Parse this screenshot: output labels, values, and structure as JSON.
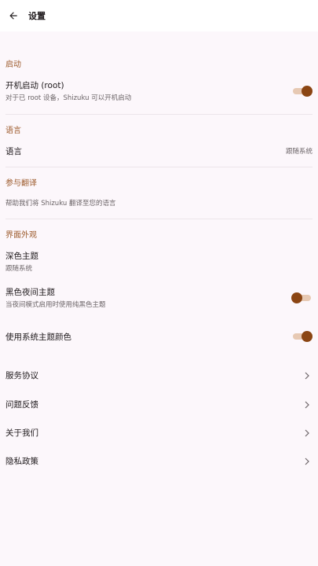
{
  "appbar": {
    "title": "设置"
  },
  "startup": {
    "section": "启动",
    "boot_title": "开机启动 (root)",
    "boot_sub": "对于已 root 设备，Shizuku 可以开机启动",
    "boot_on": true
  },
  "language": {
    "section": "语言",
    "item_title": "语言",
    "item_value": "跟随系统"
  },
  "translate": {
    "section": "参与翻译",
    "item_sub": "帮助我们将 Shizuku 翻译至您的语言"
  },
  "appearance": {
    "section": "界面外观",
    "dark_title": "深色主题",
    "dark_sub": "跟随系统",
    "black_title": "黑色夜间主题",
    "black_sub": "当夜间模式启用时使用纯黑色主题",
    "black_on": false,
    "system_color_title": "使用系统主题颜色",
    "system_color_on": true
  },
  "links": {
    "service": "服务协议",
    "feedback": "问题反馈",
    "about": "关于我们",
    "privacy": "隐私政策"
  },
  "colors": {
    "accent": "#8b4513",
    "section": "#9c5a2b",
    "background": "#fcf7fb"
  }
}
